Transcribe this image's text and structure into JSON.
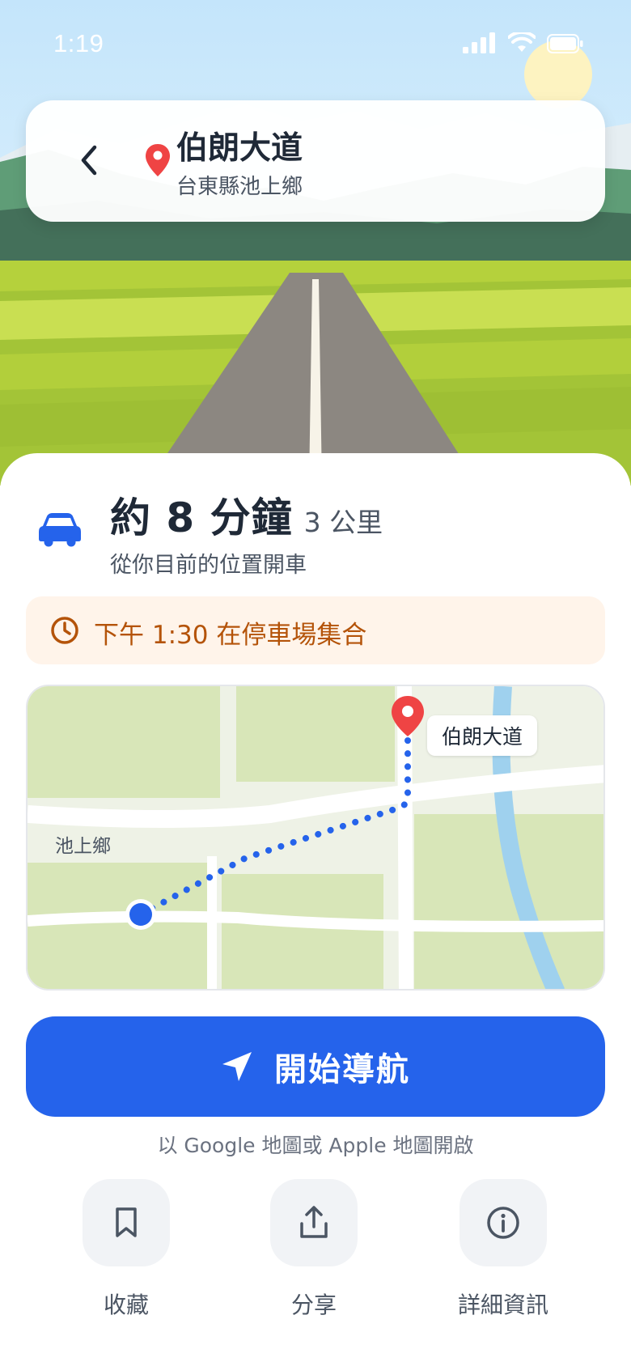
{
  "status_bar": {
    "time": "1:19"
  },
  "header": {
    "title": "伯朗大道",
    "subtitle": "台東縣池上鄉"
  },
  "trip": {
    "eta": "約 8 分鐘",
    "distance": "3 公里",
    "mode_text": "從你目前的位置開車"
  },
  "notice": {
    "text": "下午 1:30 在停車場集合"
  },
  "map": {
    "town_label": "池上鄉",
    "destination_label": "伯朗大道"
  },
  "navigation": {
    "start_label": "開始導航",
    "open_with": "以 Google 地圖或 Apple 地圖開啟"
  },
  "actions": [
    {
      "label": "收藏",
      "icon": "bookmark-icon"
    },
    {
      "label": "分享",
      "icon": "share-icon"
    },
    {
      "label": "詳細資訊",
      "icon": "info-icon"
    }
  ],
  "colors": {
    "accent": "#2563eb",
    "pin": "#ef4444",
    "notice_bg": "#fff4ea",
    "notice_text": "#b45309"
  }
}
